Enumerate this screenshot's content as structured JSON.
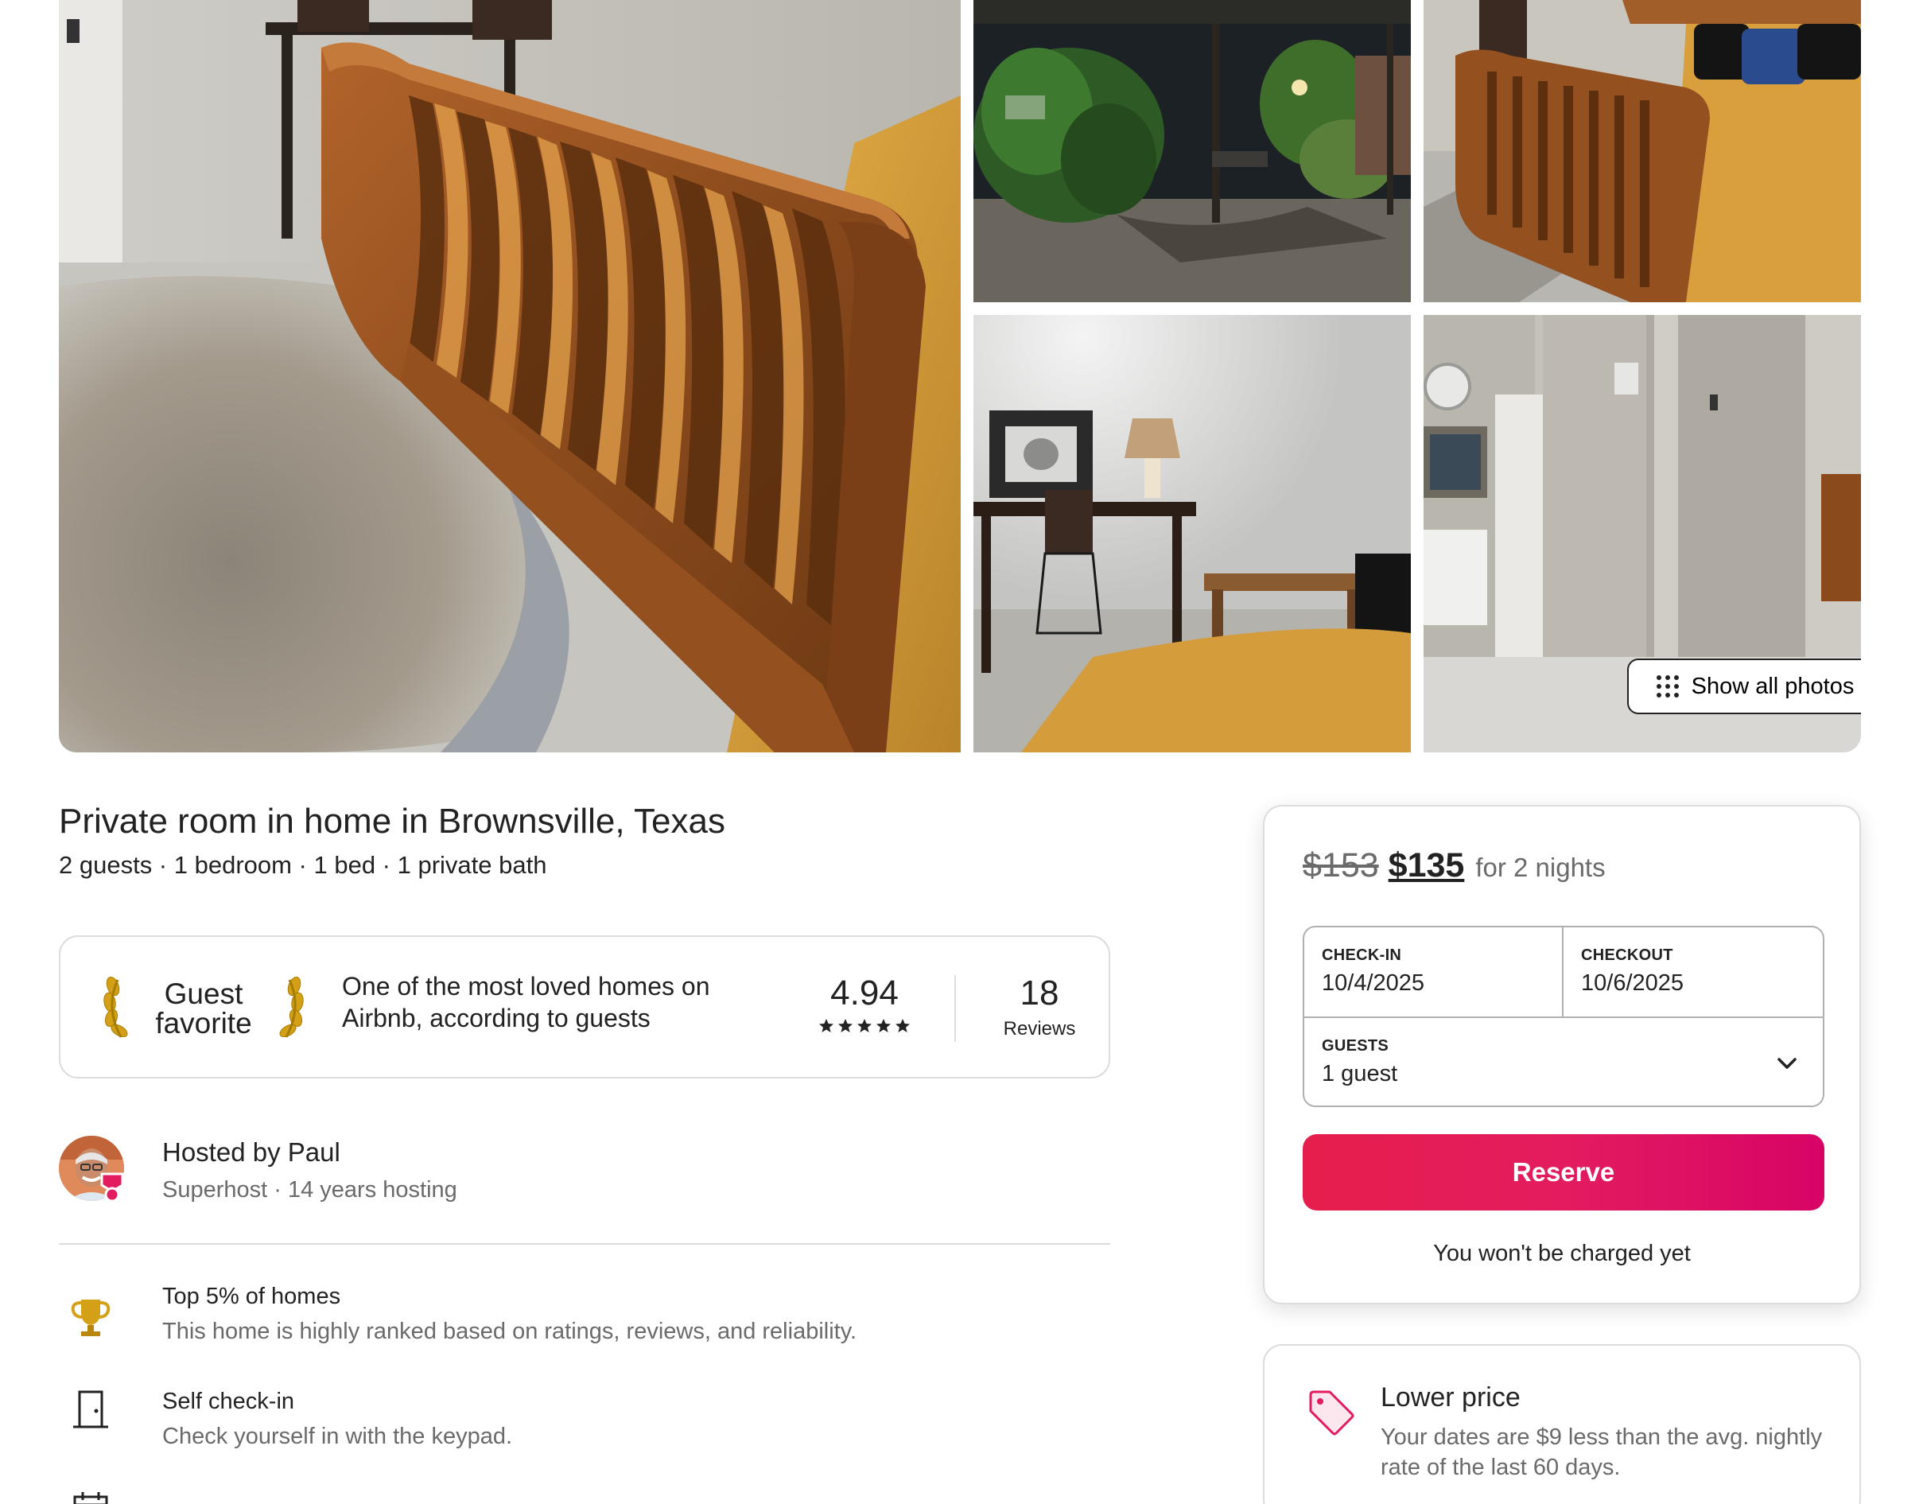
{
  "gallery": {
    "show_all_label": "Show all photos"
  },
  "listing": {
    "title": "Private room in home in Brownsville, Texas",
    "subtitle": "2 guests · 1 bedroom · 1 bed · 1 private bath"
  },
  "guest_favorite": {
    "badge_line1": "Guest",
    "badge_line2": "favorite",
    "description": "One of the most loved homes on Airbnb, according to guests",
    "rating": "4.94",
    "stars": 5,
    "reviews_count": "18",
    "reviews_label": "Reviews"
  },
  "host": {
    "name_line": "Hosted by Paul",
    "subtitle": "Superhost · 14 years hosting"
  },
  "highlights": [
    {
      "icon": "trophy-icon",
      "title": "Top 5% of homes",
      "description": "This home is highly ranked based on ratings, reviews, and reliability."
    },
    {
      "icon": "door-icon",
      "title": "Self check-in",
      "description": "Check yourself in with the keypad."
    }
  ],
  "booking": {
    "old_price": "$153",
    "new_price": "$135",
    "price_suffix": "for 2 nights",
    "checkin_label": "CHECK-IN",
    "checkin_value": "10/4/2025",
    "checkout_label": "CHECKOUT",
    "checkout_value": "10/6/2025",
    "guests_label": "GUESTS",
    "guests_value": "1 guest",
    "reserve_label": "Reserve",
    "no_charge_note": "You won't be charged yet"
  },
  "lower_price": {
    "title": "Lower price",
    "description": "Your dates are $9 less than the avg. nightly rate of the last 60 days."
  },
  "colors": {
    "brand": "#e31c5f",
    "text": "#222222",
    "muted": "#6a6a6a",
    "border": "#dddddd"
  }
}
